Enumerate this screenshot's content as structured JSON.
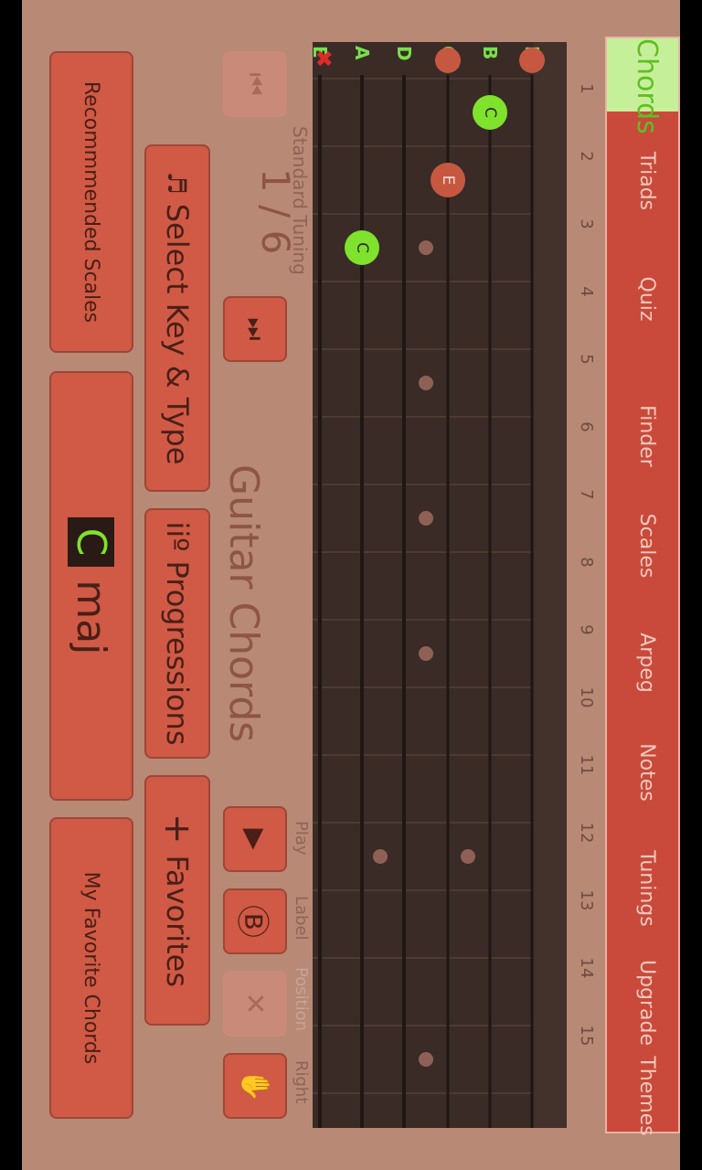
{
  "tabs": [
    "Chords",
    "Triads",
    "Quiz",
    "Finder",
    "Scales",
    "Arpeg",
    "Notes",
    "Tunings",
    "Upgrade",
    "Themes"
  ],
  "frets": [
    "1",
    "2",
    "3",
    "4",
    "5",
    "6",
    "7",
    "8",
    "9",
    "10",
    "11",
    "12",
    "13",
    "14",
    "15"
  ],
  "strings": [
    "E",
    "B",
    "G",
    "D",
    "A",
    "E"
  ],
  "notes": [
    {
      "label": "C",
      "fret": 1,
      "string": 1,
      "color": "green"
    },
    {
      "label": "E",
      "fret": 2,
      "string": 2,
      "color": "red"
    },
    {
      "label": "C",
      "fret": 3,
      "string": 4,
      "color": "green"
    }
  ],
  "open_markers": [
    {
      "type": "x",
      "string": 5
    },
    {
      "type": "o",
      "string": 2
    },
    {
      "type": "o",
      "string": 0
    }
  ],
  "tuning": "Standard Tuning",
  "page_counter": "1 / 6",
  "heading": "Guitar Chords",
  "controls": {
    "play": "Play",
    "label": "Label",
    "position": "Position",
    "right": "Right"
  },
  "buttons": {
    "select_key": "Select Key & Type",
    "progressions": "iiº Progressions",
    "favorites": "Favorites",
    "recommended": "Recommmended Scales",
    "my_favorites": "My Favorite Chords"
  },
  "chord": {
    "root": "C",
    "type": "maj"
  },
  "colors": {
    "bg": "#b88975",
    "tab": "#c94a3a",
    "active_tab": "#c6ef9a",
    "board": "#3a2b27",
    "note_green": "#7fe22c"
  }
}
